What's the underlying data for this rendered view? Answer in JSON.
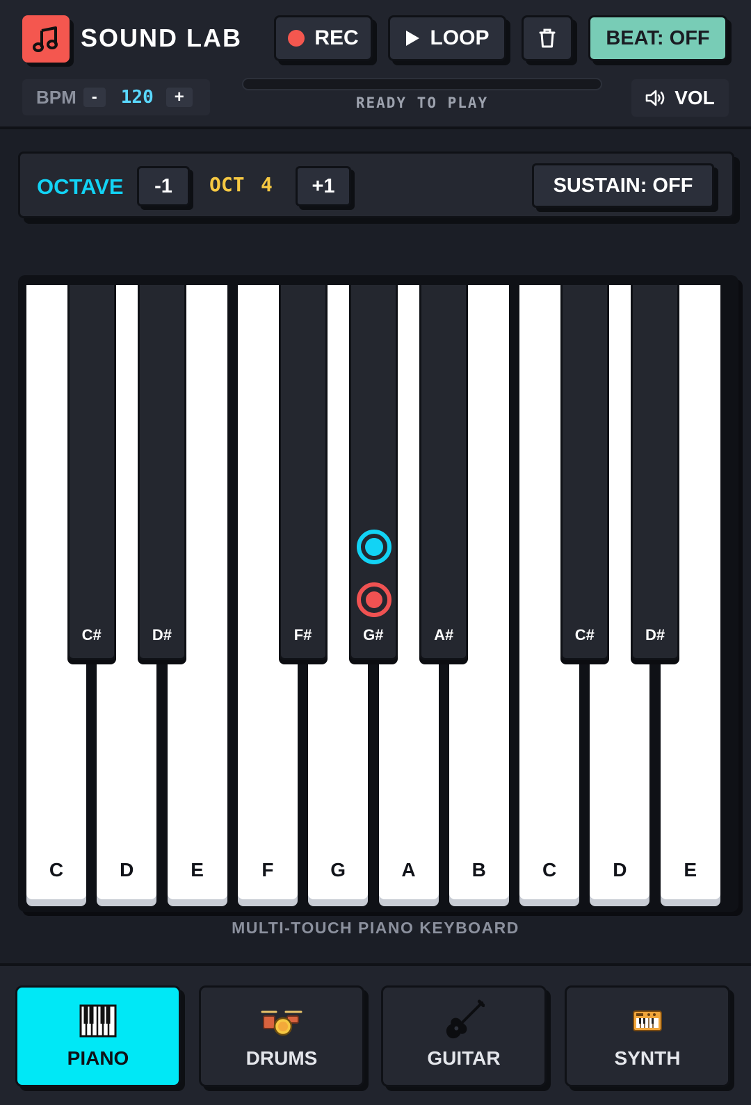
{
  "app": {
    "title": "SOUND LAB",
    "logo_icon": "music-note-icon",
    "accent_color": "#12d3f5",
    "record_color": "#f4574f"
  },
  "toolbar": {
    "rec_label": "REC",
    "loop_label": "LOOP",
    "clear_icon": "trash-icon",
    "beat_label": "BEAT: OFF"
  },
  "bpm": {
    "label": "BPM",
    "minus": "-",
    "value": "120",
    "plus": "+"
  },
  "status": {
    "text": "READY TO PLAY",
    "progress": 0
  },
  "volume": {
    "label": "VOL",
    "icon": "speaker-icon"
  },
  "octave": {
    "label": "OCTAVE",
    "minus_label": "-1",
    "name": "OCT",
    "value": "4",
    "plus_label": "+1",
    "sustain_label": "SUSTAIN: OFF"
  },
  "keyboard": {
    "white_keys": [
      "C",
      "D",
      "E",
      "F",
      "G",
      "A",
      "B",
      "C",
      "D",
      "E"
    ],
    "black_keys": [
      "C#",
      "D#",
      "F#",
      "G#",
      "A#",
      "C#",
      "D#"
    ],
    "touch_indicators": "G#",
    "caption": "MULTI-TOUCH PIANO KEYBOARD"
  },
  "tabs": [
    {
      "label": "PIANO",
      "icon": "piano-icon",
      "active": true
    },
    {
      "label": "DRUMS",
      "icon": "drum-kit-icon",
      "active": false
    },
    {
      "label": "GUITAR",
      "icon": "guitar-icon",
      "active": false
    },
    {
      "label": "SYNTH",
      "icon": "synth-icon",
      "active": false
    }
  ]
}
